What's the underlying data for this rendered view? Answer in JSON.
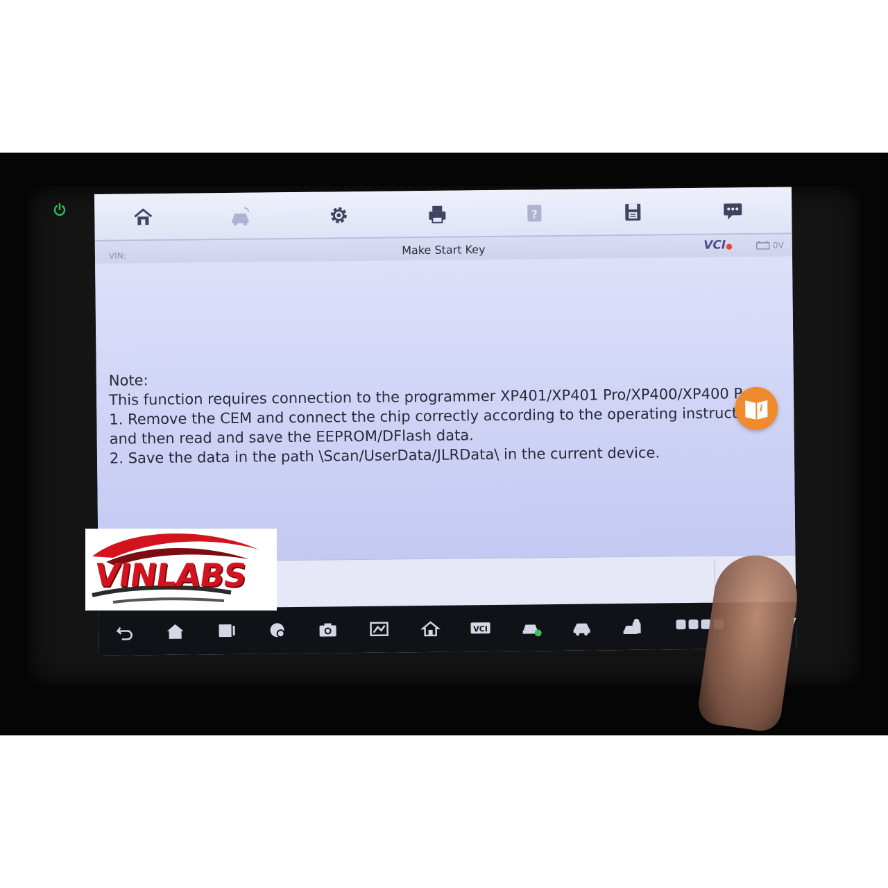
{
  "toolbar": {
    "buttons": [
      "home-icon",
      "vehicle-swap-icon",
      "settings-icon",
      "print-icon",
      "help-icon",
      "save-icon",
      "message-icon"
    ]
  },
  "header": {
    "vin_label": "VIN:",
    "title": "Make Start Key",
    "vci_label": "VCI",
    "voltage": "0V"
  },
  "note": {
    "heading": "Note:",
    "line1": "This function requires connection to the programmer XP401/XP401 Pro/XP400/XP400 P",
    "line2": "1. Remove the CEM and connect the chip correctly according to the operating instructio",
    "line3": "and then read and save the EEPROM/DFlash data.",
    "line4": "2. Save the data in the path \\Scan/UserData/JLRData\\ in the current device."
  },
  "info_button": {
    "glyph": "i"
  },
  "navbar": {
    "buttons": [
      "back-icon",
      "home-icon",
      "recent-apps-icon",
      "browser-icon",
      "camera-icon",
      "screenshot-icon",
      "home-app-icon",
      "vci-icon",
      "vehicle-diagnostic-icon",
      "car-icon",
      "remote-expert-icon"
    ],
    "vci_label": "VCI",
    "clock": "7"
  },
  "watermark": {
    "brand": "VINLABS"
  },
  "colors": {
    "accent_orange": "#ef8a2f",
    "screen_bg": "#c9cdf2",
    "power_green": "#22c35a",
    "brand_red": "#d3141f"
  }
}
